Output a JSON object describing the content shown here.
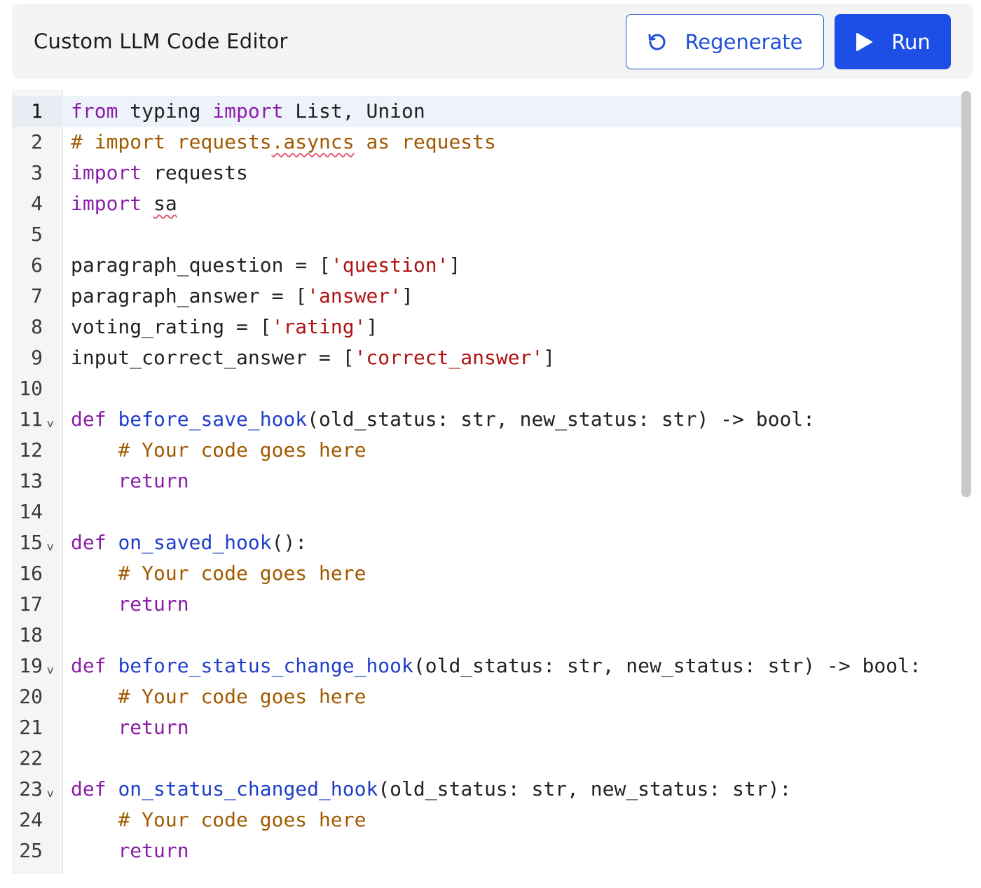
{
  "header": {
    "title": "Custom LLM Code Editor",
    "regenerate_label": "Regenerate",
    "run_label": "Run",
    "icons": {
      "regenerate": "refresh-icon",
      "run": "play-icon"
    },
    "colors": {
      "accent": "#1d4fe6",
      "header_bg": "#f4f4f4"
    }
  },
  "editor": {
    "language": "python",
    "active_line": 1,
    "lines": [
      {
        "n": "1",
        "fold": false,
        "tokens": [
          {
            "t": "from",
            "c": "kw"
          },
          {
            "t": " typing "
          },
          {
            "t": "import",
            "c": "kw"
          },
          {
            "t": " List, Union"
          }
        ]
      },
      {
        "n": "2",
        "fold": false,
        "tokens": [
          {
            "t": "# import requests",
            "c": "cm"
          },
          {
            "t": ".asyncs",
            "c": "cm",
            "u": true
          },
          {
            "t": " as requests",
            "c": "cm"
          }
        ]
      },
      {
        "n": "3",
        "fold": false,
        "tokens": [
          {
            "t": "import",
            "c": "kw"
          },
          {
            "t": " requests"
          }
        ]
      },
      {
        "n": "4",
        "fold": false,
        "tokens": [
          {
            "t": "import",
            "c": "kw"
          },
          {
            "t": " "
          },
          {
            "t": "sa",
            "u": true
          }
        ]
      },
      {
        "n": "5",
        "fold": false,
        "tokens": []
      },
      {
        "n": "6",
        "fold": false,
        "tokens": [
          {
            "t": "paragraph_question = ["
          },
          {
            "t": "'question'",
            "c": "str"
          },
          {
            "t": "]"
          }
        ]
      },
      {
        "n": "7",
        "fold": false,
        "tokens": [
          {
            "t": "paragraph_answer = ["
          },
          {
            "t": "'answer'",
            "c": "str"
          },
          {
            "t": "]"
          }
        ]
      },
      {
        "n": "8",
        "fold": false,
        "tokens": [
          {
            "t": "voting_rating = ["
          },
          {
            "t": "'rating'",
            "c": "str"
          },
          {
            "t": "]"
          }
        ]
      },
      {
        "n": "9",
        "fold": false,
        "tokens": [
          {
            "t": "input_correct_answer = ["
          },
          {
            "t": "'correct_answer'",
            "c": "str"
          },
          {
            "t": "]"
          }
        ]
      },
      {
        "n": "10",
        "fold": false,
        "tokens": []
      },
      {
        "n": "11",
        "fold": true,
        "tokens": [
          {
            "t": "def",
            "c": "kw"
          },
          {
            "t": " "
          },
          {
            "t": "before_save_hook",
            "c": "fn"
          },
          {
            "t": "(old_status: str, new_status: str) -> bool:"
          }
        ]
      },
      {
        "n": "12",
        "fold": false,
        "tokens": [
          {
            "t": "    "
          },
          {
            "t": "# Your code goes here",
            "c": "cm"
          }
        ]
      },
      {
        "n": "13",
        "fold": false,
        "tokens": [
          {
            "t": "    "
          },
          {
            "t": "return",
            "c": "kw"
          }
        ]
      },
      {
        "n": "14",
        "fold": false,
        "tokens": []
      },
      {
        "n": "15",
        "fold": true,
        "tokens": [
          {
            "t": "def",
            "c": "kw"
          },
          {
            "t": " "
          },
          {
            "t": "on_saved_hook",
            "c": "fn"
          },
          {
            "t": "():"
          }
        ]
      },
      {
        "n": "16",
        "fold": false,
        "tokens": [
          {
            "t": "    "
          },
          {
            "t": "# Your code goes here",
            "c": "cm"
          }
        ]
      },
      {
        "n": "17",
        "fold": false,
        "tokens": [
          {
            "t": "    "
          },
          {
            "t": "return",
            "c": "kw"
          }
        ]
      },
      {
        "n": "18",
        "fold": false,
        "tokens": []
      },
      {
        "n": "19",
        "fold": true,
        "tokens": [
          {
            "t": "def",
            "c": "kw"
          },
          {
            "t": " "
          },
          {
            "t": "before_status_change_hook",
            "c": "fn"
          },
          {
            "t": "(old_status: str, new_status: str) -> bool:"
          }
        ]
      },
      {
        "n": "20",
        "fold": false,
        "tokens": [
          {
            "t": "    "
          },
          {
            "t": "# Your code goes here",
            "c": "cm"
          }
        ]
      },
      {
        "n": "21",
        "fold": false,
        "tokens": [
          {
            "t": "    "
          },
          {
            "t": "return",
            "c": "kw"
          }
        ]
      },
      {
        "n": "22",
        "fold": false,
        "tokens": []
      },
      {
        "n": "23",
        "fold": true,
        "tokens": [
          {
            "t": "def",
            "c": "kw"
          },
          {
            "t": " "
          },
          {
            "t": "on_status_changed_hook",
            "c": "fn"
          },
          {
            "t": "(old_status: str, new_status: str):"
          }
        ]
      },
      {
        "n": "24",
        "fold": false,
        "tokens": [
          {
            "t": "    "
          },
          {
            "t": "# Your code goes here",
            "c": "cm"
          }
        ]
      },
      {
        "n": "25",
        "fold": false,
        "tokens": [
          {
            "t": "    "
          },
          {
            "t": "return",
            "c": "kw"
          }
        ]
      }
    ],
    "fold_marker": "v"
  }
}
